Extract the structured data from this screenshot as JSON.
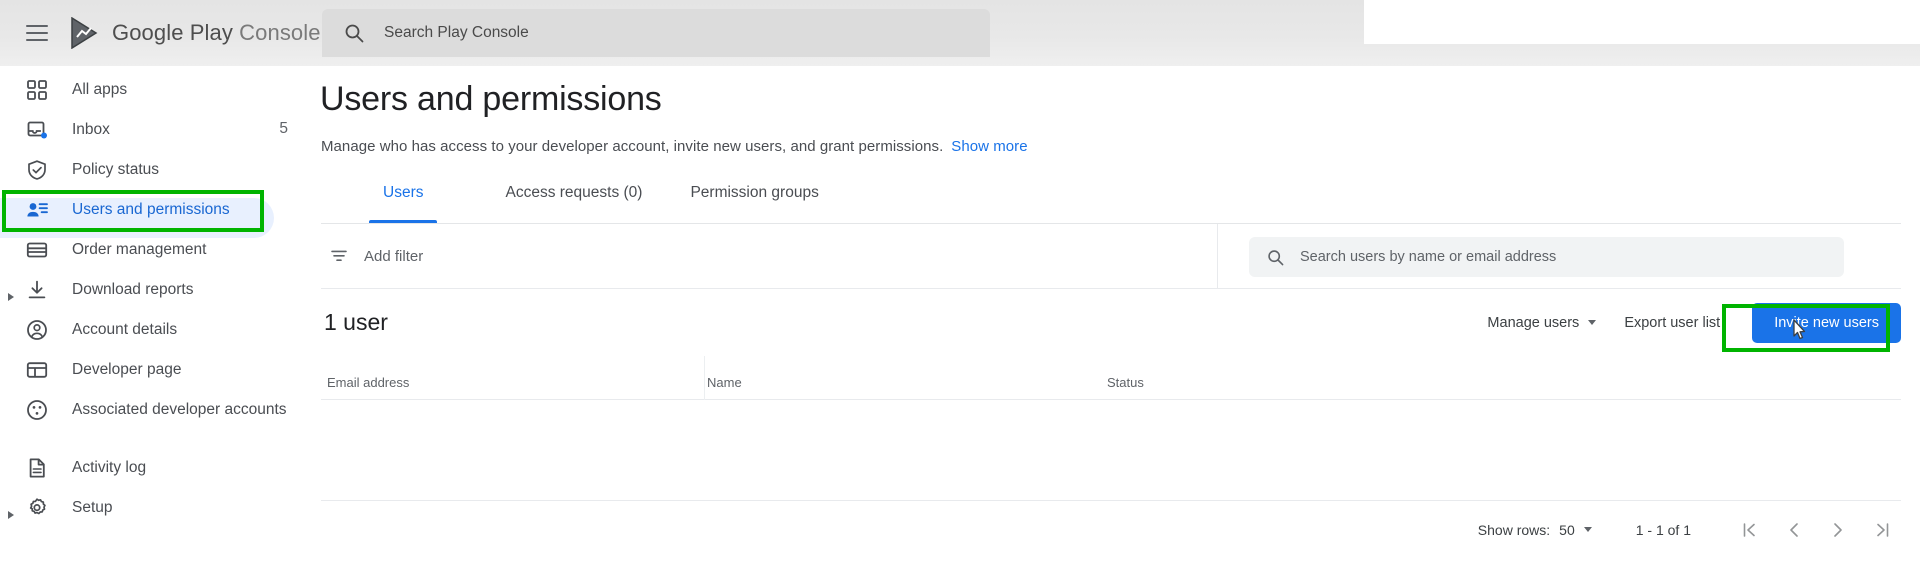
{
  "header": {
    "menu_icon": "hamburger-menu-icon",
    "logo_icon": "google-play-logo-icon",
    "brand_primary": "Google Play",
    "brand_secondary": "Console",
    "search": {
      "icon": "search-icon",
      "placeholder": "Search Play Console",
      "value": ""
    }
  },
  "sidebar": {
    "items": [
      {
        "label": "All apps",
        "icon": "grid-apps-icon",
        "active": false,
        "expandable": false,
        "count": ""
      },
      {
        "label": "Inbox",
        "icon": "inbox-icon",
        "active": false,
        "expandable": false,
        "count": "5"
      },
      {
        "label": "Policy status",
        "icon": "shield-check-icon",
        "active": false,
        "expandable": false,
        "count": ""
      },
      {
        "label": "Users and permissions",
        "icon": "users-permissions-icon",
        "active": true,
        "expandable": false,
        "count": ""
      },
      {
        "label": "Order management",
        "icon": "credit-card-icon",
        "active": false,
        "expandable": false,
        "count": ""
      },
      {
        "label": "Download reports",
        "icon": "download-icon",
        "active": false,
        "expandable": true,
        "count": ""
      },
      {
        "label": "Account details",
        "icon": "account-circle-icon",
        "active": false,
        "expandable": false,
        "count": ""
      },
      {
        "label": "Developer page",
        "icon": "developer-page-icon",
        "active": false,
        "expandable": false,
        "count": ""
      },
      {
        "label": "Associated developer accounts",
        "icon": "associated-accounts-icon",
        "active": false,
        "expandable": false,
        "count": ""
      },
      {
        "label": "Activity log",
        "icon": "document-lines-icon",
        "active": false,
        "expandable": false,
        "count": ""
      },
      {
        "label": "Setup",
        "icon": "gear-icon",
        "active": false,
        "expandable": true,
        "count": ""
      }
    ]
  },
  "main": {
    "title": "Users and permissions",
    "description": "Manage who has access to your developer account, invite new users, and grant permissions.",
    "show_more": "Show more",
    "tabs": [
      {
        "label": "Users",
        "active": true
      },
      {
        "label": "Access requests (0)",
        "active": false
      },
      {
        "label": "Permission groups",
        "active": false
      }
    ],
    "filter": {
      "icon": "filter-icon",
      "label": "Add filter"
    },
    "user_search": {
      "icon": "search-icon",
      "placeholder": "Search users by name or email address",
      "value": ""
    },
    "count_title": "1 user",
    "actions": {
      "manage_users": "Manage users",
      "manage_users_caret": "chevron-down-icon",
      "export_user_list": "Export user list",
      "invite_new_users": "Invite new users"
    },
    "table": {
      "columns": [
        "Email address",
        "Name",
        "Status"
      ],
      "rows": []
    },
    "pagination": {
      "show_rows_label": "Show rows:",
      "rows_value": "50",
      "range": "1 - 1 of 1",
      "first_icon": "first-page-icon",
      "prev_icon": "chevron-left-icon",
      "next_icon": "chevron-right-icon",
      "last_icon": "last-page-icon"
    }
  },
  "annotations": {
    "color": "#00b400",
    "sidebar_target": "Users and permissions",
    "button_target": "Invite new users"
  },
  "colors": {
    "accent_blue": "#1a73e8",
    "active_nav_bg": "#e8f0fe",
    "active_nav_text": "#1967d2",
    "annotation_green": "#00b400",
    "header_bg": "#e8e8e8",
    "text_primary": "#202124",
    "text_secondary": "#5f6368"
  }
}
